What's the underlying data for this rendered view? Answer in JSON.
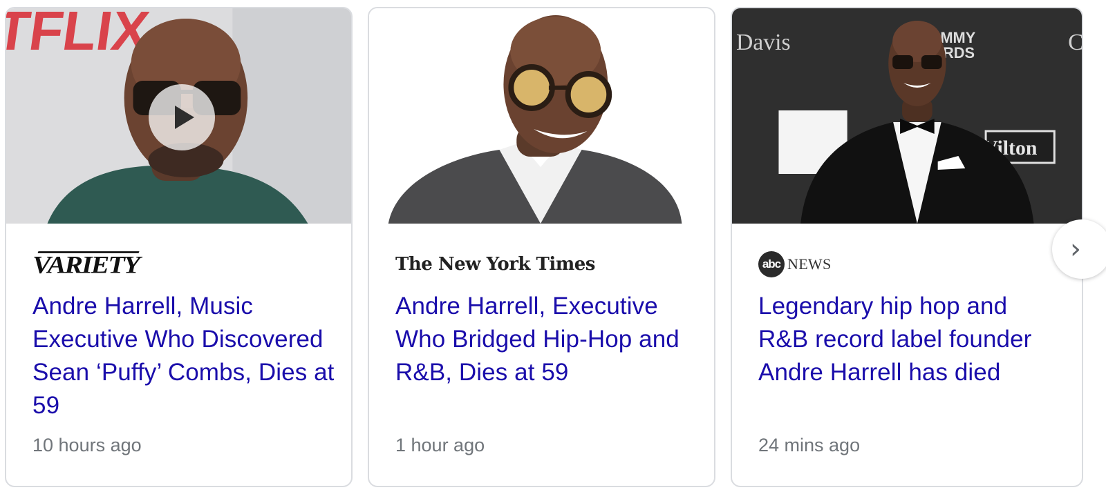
{
  "cards": [
    {
      "source": "VARIETY",
      "title": "Andre Harrell, Music Executive Who Discovered Sean ‘Puffy’ Combs, Dies at 59",
      "time": "10 hours ago",
      "has_video": true,
      "backdrop_text": "TFLIX"
    },
    {
      "source": "The New York Times",
      "title": "Andre Harrell, Executive Who Bridged Hip-Hop and R&B, Dies at 59",
      "time": "1 hour ago",
      "has_video": false
    },
    {
      "source_badge": "abc",
      "source": "NEWS",
      "title": "Legendary hip hop and R&B record label founder Andre Harrell has died",
      "time": "24 mins ago",
      "has_video": false,
      "backdrop_texts": [
        "Davis",
        "RAMMY",
        "WARDS",
        "Vilton",
        "C"
      ]
    }
  ],
  "icons": {
    "play": "play-icon",
    "next": "chevron-right-icon",
    "next_glyph": "›"
  },
  "colors": {
    "link": "#1a0dab",
    "meta": "#70757a",
    "border": "#dadce0"
  }
}
